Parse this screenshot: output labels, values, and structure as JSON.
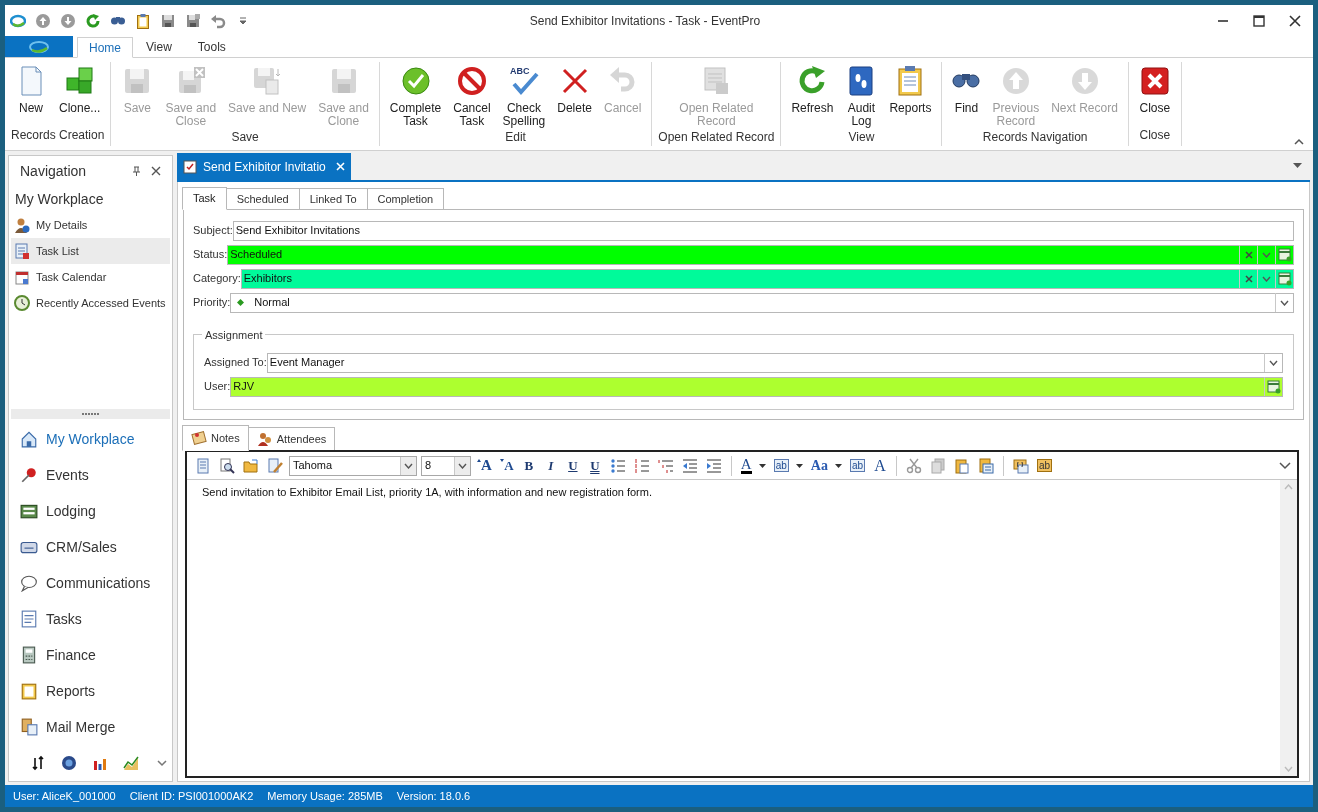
{
  "window": {
    "title": "Send Exhibitor Invitations - Task - EventPro"
  },
  "ribbon_tabs": [
    {
      "label": "Home",
      "selected": true
    },
    {
      "label": "View",
      "selected": false
    },
    {
      "label": "Tools",
      "selected": false
    }
  ],
  "ribbon_groups": [
    {
      "label": "Records Creation",
      "buttons": [
        {
          "kind": "new",
          "label": "New",
          "disabled": false
        },
        {
          "kind": "clone",
          "label": "Clone...",
          "disabled": false
        }
      ]
    },
    {
      "label": "Save",
      "buttons": [
        {
          "kind": "save",
          "label": "Save",
          "disabled": true
        },
        {
          "kind": "save-close",
          "label": "Save and\nClose",
          "disabled": true
        },
        {
          "kind": "save-new",
          "label": "Save and New",
          "disabled": true
        },
        {
          "kind": "save-clone",
          "label": "Save and\nClone",
          "disabled": true
        }
      ]
    },
    {
      "label": "Edit",
      "buttons": [
        {
          "kind": "complete",
          "label": "Complete\nTask",
          "disabled": false
        },
        {
          "kind": "cancel-task",
          "label": "Cancel\nTask",
          "disabled": false
        },
        {
          "kind": "spelling",
          "label": "Check\nSpelling",
          "icon_text": "ABC",
          "disabled": false
        },
        {
          "kind": "delete",
          "label": "Delete",
          "disabled": false
        },
        {
          "kind": "undo",
          "label": "Cancel",
          "disabled": true
        }
      ]
    },
    {
      "label": "Open Related Record",
      "buttons": [
        {
          "kind": "related",
          "label": "Open Related\nRecord",
          "disabled": true
        }
      ]
    },
    {
      "label": "View",
      "buttons": [
        {
          "kind": "refresh",
          "label": "Refresh",
          "disabled": false
        },
        {
          "kind": "audit",
          "label": "Audit\nLog",
          "disabled": false
        },
        {
          "kind": "reports",
          "label": "Reports",
          "disabled": false
        }
      ]
    },
    {
      "label": "Records Navigation",
      "buttons": [
        {
          "kind": "find",
          "label": "Find",
          "disabled": false
        },
        {
          "kind": "previous",
          "label": "Previous\nRecord",
          "disabled": true
        },
        {
          "kind": "next",
          "label": "Next Record",
          "disabled": true
        }
      ]
    },
    {
      "label": "Close",
      "buttons": [
        {
          "kind": "close",
          "label": "Close",
          "disabled": false
        }
      ]
    }
  ],
  "navigation": {
    "title": "Navigation",
    "heading": "My Workplace",
    "items": [
      {
        "kind": "details",
        "label": "My Details",
        "selected": false
      },
      {
        "kind": "list",
        "label": "Task List",
        "selected": true
      },
      {
        "kind": "calendar",
        "label": "Task Calendar",
        "selected": false
      },
      {
        "kind": "clock",
        "label": "Recently Accessed Events",
        "selected": false
      }
    ],
    "sections": [
      {
        "kind": "home",
        "label": "My Workplace",
        "selected": true
      },
      {
        "kind": "pin",
        "label": "Events",
        "selected": false
      },
      {
        "kind": "lodging",
        "label": "Lodging",
        "selected": false
      },
      {
        "kind": "crm",
        "label": "CRM/Sales",
        "selected": false
      },
      {
        "kind": "bubble",
        "label": "Communications",
        "selected": false
      },
      {
        "kind": "tasks",
        "label": "Tasks",
        "selected": false
      },
      {
        "kind": "finance",
        "label": "Finance",
        "selected": false
      },
      {
        "kind": "reports",
        "label": "Reports",
        "selected": false
      },
      {
        "kind": "merge",
        "label": "Mail Merge",
        "selected": false
      }
    ]
  },
  "document_tab": {
    "title": "Send Exhibitor Invitatio"
  },
  "form_tabs": [
    {
      "label": "Task",
      "selected": true
    },
    {
      "label": "Scheduled",
      "selected": false
    },
    {
      "label": "Linked To",
      "selected": false
    },
    {
      "label": "Completion",
      "selected": false
    }
  ],
  "fields": [
    {
      "kind": "text",
      "label": "Subject:",
      "value": "Send Exhibitor Invitations"
    },
    {
      "kind": "lookup",
      "label": "Status:",
      "value": "Scheduled",
      "color": "#00ff00"
    },
    {
      "kind": "lookup",
      "label": "Category:",
      "value": "Exhibitors",
      "color": "#00fa9a"
    },
    {
      "kind": "priority",
      "label": "Priority:",
      "value": "Normal"
    }
  ],
  "assignment": {
    "title": "Assignment",
    "fields": [
      {
        "kind": "dropdown",
        "label": "Assigned To:",
        "value": "Event Manager"
      },
      {
        "kind": "picker",
        "label": "User:",
        "value": "RJV",
        "color": "#adff2f"
      }
    ]
  },
  "bottom_tabs": [
    {
      "kind": "notes",
      "label": "Notes",
      "selected": true
    },
    {
      "kind": "attendees",
      "label": "Attendees",
      "selected": false
    }
  ],
  "editor_toolbar": [
    {
      "kind": "page"
    },
    {
      "kind": "preview"
    },
    {
      "kind": "open"
    },
    {
      "kind": "edit"
    },
    {
      "kind": "font",
      "value": "Tahoma"
    },
    {
      "kind": "size",
      "value": "8"
    },
    {
      "kind": "grow",
      "label": "A"
    },
    {
      "kind": "shrink",
      "label": "A"
    },
    {
      "kind": "bold",
      "label": "B"
    },
    {
      "kind": "italic",
      "label": "I"
    },
    {
      "kind": "underline",
      "label": "U"
    },
    {
      "kind": "double-underline",
      "label": "U"
    },
    {
      "kind": "bullets"
    },
    {
      "kind": "numbering"
    },
    {
      "kind": "multilevel"
    },
    {
      "kind": "outdent"
    },
    {
      "kind": "indent"
    },
    {
      "kind": "separator"
    },
    {
      "kind": "font-color",
      "label": "A"
    },
    {
      "kind": "highlight",
      "label": "ab"
    },
    {
      "kind": "case",
      "label": "Aa"
    },
    {
      "kind": "clear",
      "label": "ab"
    },
    {
      "kind": "font-dialog",
      "label": "A"
    },
    {
      "kind": "separator"
    },
    {
      "kind": "cut"
    },
    {
      "kind": "copy"
    },
    {
      "kind": "paste"
    },
    {
      "kind": "paste-special"
    },
    {
      "kind": "separator"
    },
    {
      "kind": "field"
    },
    {
      "kind": "merge-field",
      "label": "ab"
    }
  ],
  "notes_text": "Send invitation to Exhibitor Email List, priority 1A, with information and new registration form.",
  "status_bar": [
    "User: AliceK_001000",
    "Client ID: PSI001000AK2",
    "Memory Usage: 285MB",
    "Version: 18.0.6"
  ]
}
